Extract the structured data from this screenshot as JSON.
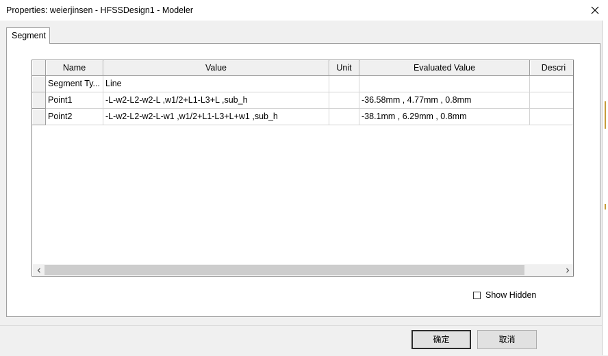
{
  "window": {
    "title": "Properties: weierjinsen - HFSSDesign1 - Modeler"
  },
  "tabs": [
    {
      "label": "Segment"
    }
  ],
  "grid": {
    "columns": [
      "Name",
      "Value",
      "Unit",
      "Evaluated Value",
      "Descri"
    ],
    "rows": [
      {
        "name": "Segment Ty...",
        "value": "Line",
        "unit": "",
        "evaluated": "",
        "description": ""
      },
      {
        "name": "Point1",
        "value": "-L-w2-L2-w2-L ,w1/2+L1-L3+L ,sub_h",
        "unit": "",
        "evaluated": "-36.58mm , 4.77mm , 0.8mm",
        "description": ""
      },
      {
        "name": "Point2",
        "value": "-L-w2-L2-w2-L-w1 ,w1/2+L1-L3+L+w1 ,sub_h",
        "unit": "",
        "evaluated": "-38.1mm , 6.29mm , 0.8mm",
        "description": ""
      }
    ]
  },
  "show_hidden": {
    "label": "Show Hidden",
    "checked": false
  },
  "buttons": {
    "ok": "确定",
    "cancel": "取消"
  }
}
